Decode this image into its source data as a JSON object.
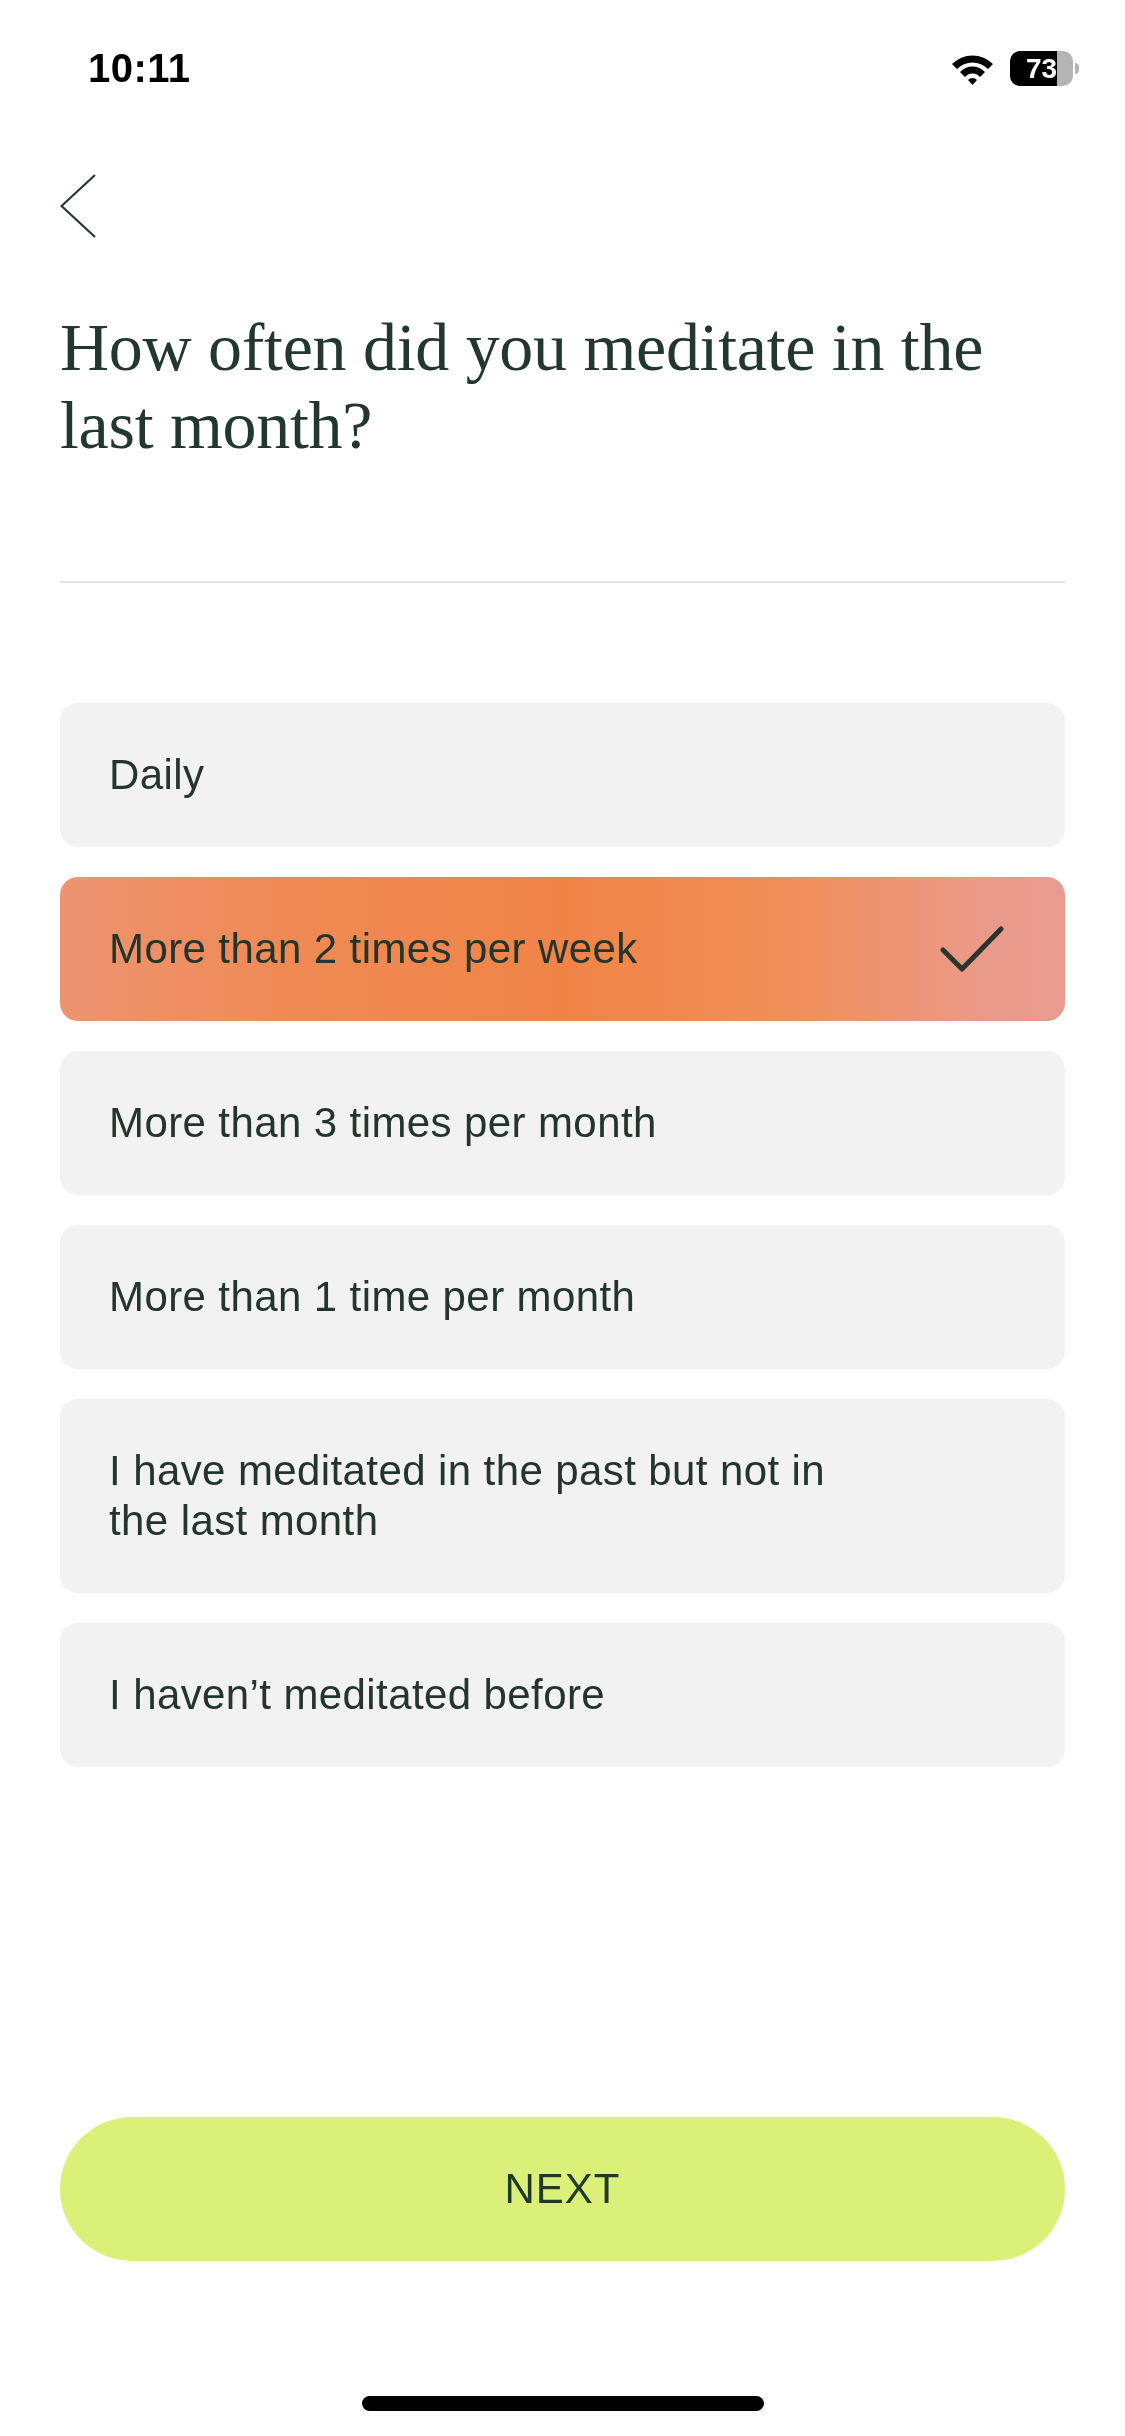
{
  "status_bar": {
    "time": "10:11",
    "battery": "73"
  },
  "question": {
    "title": "How often did you meditate in the last month?"
  },
  "options": [
    {
      "label": "Daily",
      "selected": false
    },
    {
      "label": "More than 2 times per week",
      "selected": true
    },
    {
      "label": "More than 3 times per month",
      "selected": false
    },
    {
      "label": "More than 1 time per month",
      "selected": false
    },
    {
      "label": "I have meditated in the past but not in the last month",
      "selected": false
    },
    {
      "label": "I haven’t meditated before",
      "selected": false
    }
  ],
  "next_button": {
    "label": "NEXT"
  }
}
